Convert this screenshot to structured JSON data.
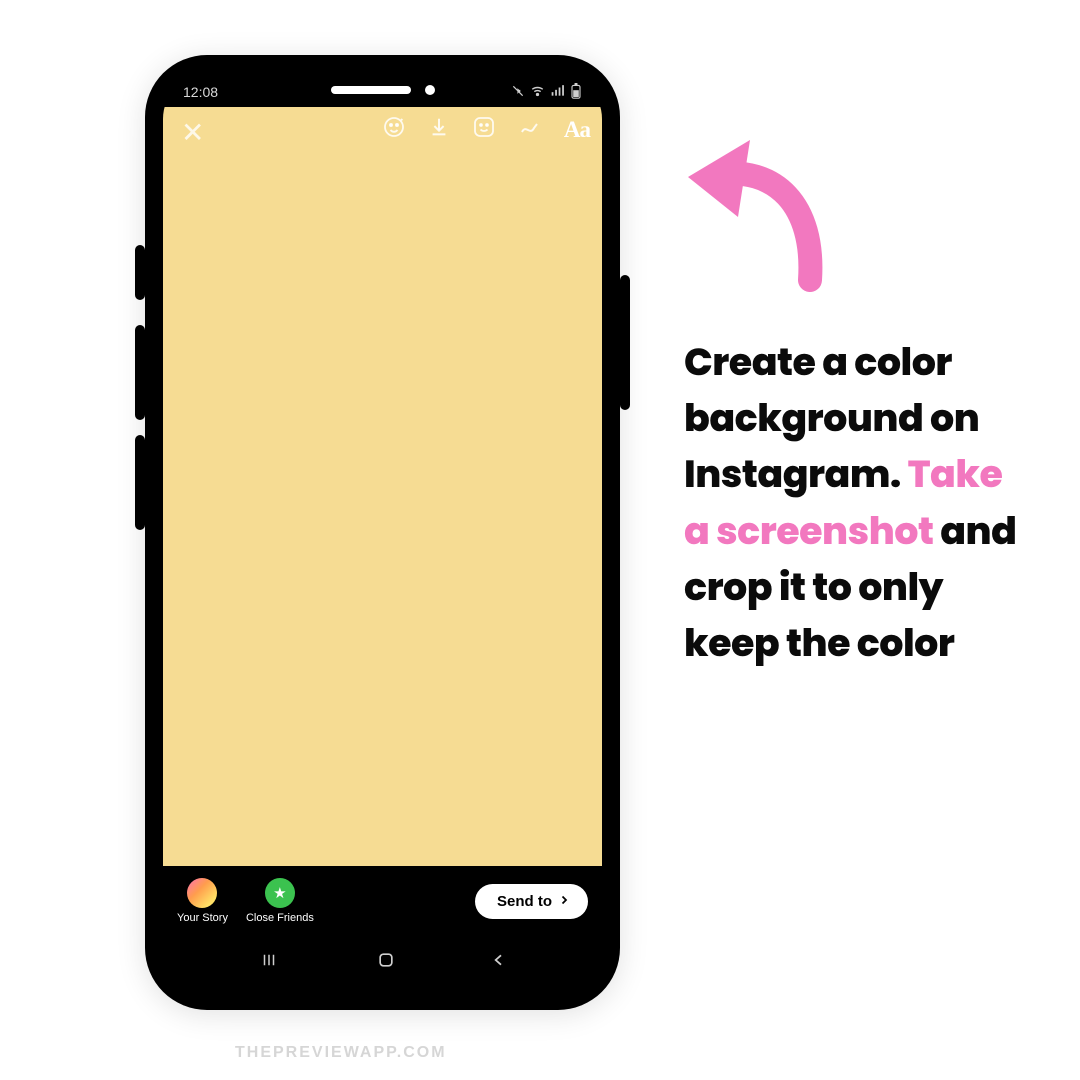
{
  "phone": {
    "status_time": "12:08",
    "toolbar": {
      "close": "✕",
      "face_icon": "face-filter-icon",
      "download_icon": "download-icon",
      "sticker_icon": "sticker-icon",
      "draw_icon": "draw-icon",
      "text_label": "Aa"
    },
    "story_bg_color": "#f6dc93",
    "bottom": {
      "your_story": "Your Story",
      "close_friends": "Close Friends",
      "send_to": "Send to"
    }
  },
  "instruction": {
    "line1": "Create a color background on Instagram. ",
    "highlight": "Take a screenshot",
    "line2": " and crop it to only keep the color"
  },
  "colors": {
    "pink": "#f278bf"
  },
  "watermark": "THEPREVIEWAPP.COM"
}
